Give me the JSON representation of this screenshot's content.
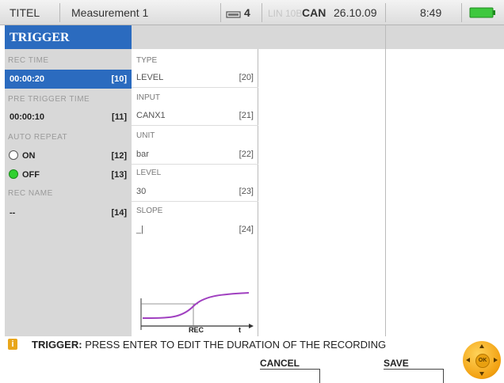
{
  "status": {
    "app_title": "TITEL",
    "measurement": "Measurement 1",
    "device_count": "4",
    "can_dim": "LIN 10B",
    "can_label": "CAN",
    "date": "26.10.09",
    "time": "8:49"
  },
  "left": {
    "tab_title": "TRIGGER",
    "rec_time_label": "REC TIME",
    "rec_time_value": "00:00:20",
    "rec_time_key": "[10]",
    "pre_trigger_label": "PRE TRIGGER TIME",
    "pre_trigger_value": "00:00:10",
    "pre_trigger_key": "[11]",
    "auto_repeat_label": "AUTO REPEAT",
    "on_label": "ON",
    "on_key": "[12]",
    "off_label": "OFF",
    "off_key": "[13]",
    "rec_name_label": "REC NAME",
    "rec_name_value": "--",
    "rec_name_key": "[14]"
  },
  "middle": {
    "type_label": "TYPE",
    "type_value": "LEVEL",
    "type_key": "[20]",
    "input_label": "INPUT",
    "input_value": "CANX1",
    "input_key": "[21]",
    "unit_label": "UNIT",
    "unit_value": "bar",
    "unit_key": "[22]",
    "level_label": "LEVEL",
    "level_value": "30",
    "level_key": "[23]",
    "slope_label": "SLOPE",
    "slope_value": "_|",
    "slope_key": "[24]",
    "graph_rec_label": "REC",
    "graph_t_label": "t"
  },
  "bottom": {
    "info_icon": "i",
    "info_bold": "TRIGGER:",
    "info_text": "PRESS ENTER TO EDIT THE DURATION OF THE RECORDING",
    "cancel_label": "CANCEL",
    "save_label": "SAVE",
    "ok_label": "OK"
  },
  "colors": {
    "accent": "#2b6bbf",
    "panel_gray": "#d8d8d8",
    "radio_on": "#30d030",
    "graph_curve": "#a040c0",
    "battery": "#3ec83e"
  },
  "icons": [
    "device-icon",
    "battery-icon",
    "info-icon",
    "ok-navigation-icon"
  ]
}
